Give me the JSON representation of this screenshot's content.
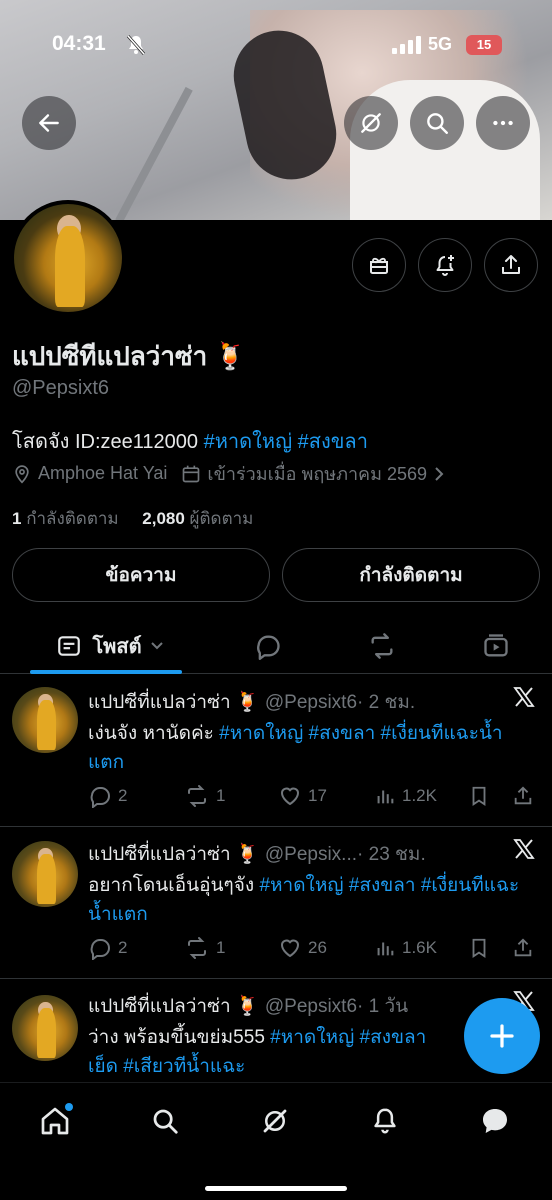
{
  "status_bar": {
    "time": "04:31",
    "network": "5G",
    "battery": "15"
  },
  "profile": {
    "name": "แปปซีทีแปลว่าซ่า 🍹",
    "handle": "@Pepsixt6",
    "bio_text": "โสดจัง ID:zee112000 ",
    "bio_tags": "#หาดใหญ่ #สงขลา",
    "location": "Amphoe Hat Yai",
    "joined": "เข้าร่วมเมื่อ พฤษภาคม 2569",
    "following_count": "1",
    "following_label": "กำลังติดตาม",
    "followers_count": "2,080",
    "followers_label": "ผู้ติดตาม"
  },
  "buttons": {
    "message": "ข้อความ",
    "following": "กำลังติดตาม"
  },
  "tabs": {
    "posts": "โพสต์"
  },
  "posts": [
    {
      "name": "แปปซีที่แปลว่าซ่า 🍹",
      "handle": "@Pepsixt6",
      "time": "· 2 ชม.",
      "text_plain": "เง่นจัง หานัดค่ะ ",
      "text_tags": "#หาดใหญ่ #สงขลา #เงี่ยนทีแฉะน้ำแตก",
      "replies": "2",
      "reposts": "1",
      "likes": "17",
      "views": "1.2K"
    },
    {
      "name": "แปปซีที่แปลว่าซ่า 🍹",
      "handle": "@Pepsix...",
      "time": "· 23 ชม.",
      "text_plain": "อยากโดนเอ็นอุ่นๆจัง ",
      "text_tags": "#หาดใหญ่ #สงขลา #เงี่ยนทีแฉะน้ำแตก",
      "replies": "2",
      "reposts": "1",
      "likes": "26",
      "views": "1.6K"
    },
    {
      "name": "แปปซีที่แปลว่าซ่า 🍹",
      "handle": "@Pepsixt6",
      "time": "· 1 วัน",
      "text_plain": "ว่าง พร้อมขึ้นขย่ม555 ",
      "text_tags": "#หาดใหญ่ #สงขลา",
      "text_line2": "เย็ด #เสียวทีน้ำแฉะ"
    }
  ],
  "colors": {
    "accent": "#1d9bf0",
    "muted": "#71767b",
    "text": "#e7e9ea",
    "background": "#000000"
  }
}
